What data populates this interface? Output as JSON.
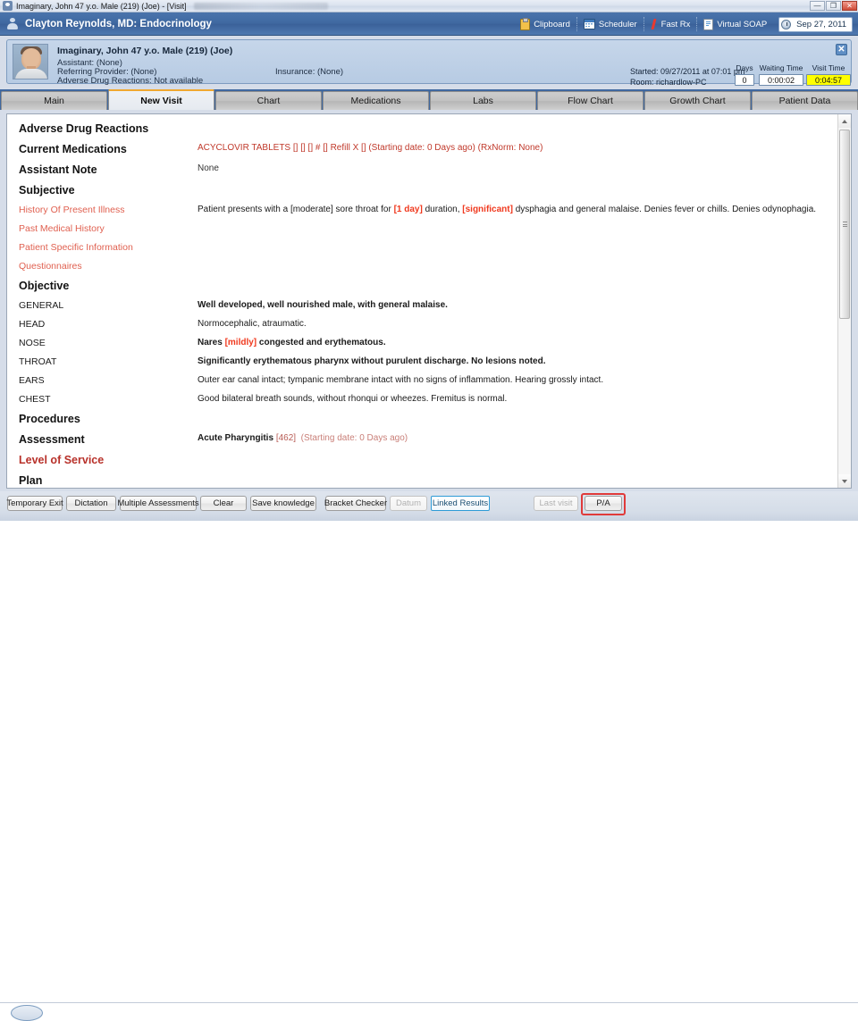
{
  "window": {
    "title": "Imaginary, John 47 y.o. Male (219) (Joe) - [Visit]",
    "icon": "user-icon",
    "buttons": {
      "minimize": "—",
      "maximize": "❐",
      "close": "✕"
    }
  },
  "app_header": {
    "title": "Clayton Reynolds, MD: Endocrinology",
    "user_icon": "user-icon",
    "tools": [
      {
        "label": "Clipboard",
        "icon": "clipboard-icon"
      },
      {
        "label": "Scheduler",
        "icon": "calendar-icon"
      },
      {
        "label": "Fast Rx",
        "icon": "prescription-icon"
      },
      {
        "label": "Virtual SOAP",
        "icon": "document-icon"
      }
    ],
    "date": {
      "label": "Sep 27, 2011",
      "icon": "clock-icon"
    }
  },
  "patient_banner": {
    "avatar": "patient-photo",
    "name": "Imaginary, John 47 y.o. Male (219) (Joe)",
    "assistant": "Assistant: (None)",
    "referring_provider": "Referring Provider: (None)",
    "adverse_drug_reactions": "Adverse Drug Reactions: Not available",
    "insurance": "Insurance: (None)",
    "started": "Started: 09/27/2011 at 07:01 pm",
    "room": "Room: richardlow-PC",
    "timers": [
      {
        "label": "Days",
        "value": "0",
        "highlight": false
      },
      {
        "label": "Waiting Time",
        "value": "0:00:02",
        "highlight": false
      },
      {
        "label": "Visit Time",
        "value": "0:04:57",
        "highlight": true
      }
    ],
    "close_icon": "close-icon"
  },
  "tabs": [
    {
      "label": "Main",
      "active": false
    },
    {
      "label": "New Visit",
      "active": true
    },
    {
      "label": "Chart",
      "active": false
    },
    {
      "label": "Medications",
      "active": false
    },
    {
      "label": "Labs",
      "active": false
    },
    {
      "label": "Flow Chart",
      "active": false
    },
    {
      "label": "Growth Chart",
      "active": false
    },
    {
      "label": "Patient Data",
      "active": false
    }
  ],
  "note": {
    "adverse_drug_reactions": {
      "label": "Adverse Drug Reactions",
      "value": ""
    },
    "current_medications": {
      "label": "Current Medications",
      "value": "ACYCLOVIR TABLETS  [] [] []  # []   Refill X []   (Starting date: 0 Days ago) (RxNorm: None)"
    },
    "assistant_note": {
      "label": "Assistant Note",
      "value": "None"
    },
    "subjective": {
      "label": "Subjective",
      "items": [
        {
          "label": "History Of Present Illness"
        },
        {
          "label": "Past Medical History"
        },
        {
          "label": "Patient Specific Information"
        },
        {
          "label": "Questionnaires"
        }
      ],
      "hpi_parts": [
        {
          "text": "Patient presents with a [moderate]  sore throat for ",
          "style": "plain"
        },
        {
          "text": "[1 day]",
          "style": "highlight"
        },
        {
          "text": "  duration, ",
          "style": "plain"
        },
        {
          "text": "[significant]",
          "style": "highlight"
        },
        {
          "text": "  dysphagia and general malaise. Denies fever or chills. Denies odynophagia.",
          "style": "plain"
        }
      ]
    },
    "objective": {
      "label": "Objective",
      "rows": [
        {
          "label": "GENERAL",
          "value": "Well developed, well nourished male, with general malaise.",
          "bold": true
        },
        {
          "label": "HEAD",
          "value": "Normocephalic, atraumatic.",
          "bold": false
        },
        {
          "label": "NOSE",
          "value": "",
          "bold": true,
          "parts": [
            {
              "text": "Nares ",
              "style": "bold"
            },
            {
              "text": "[mildly]",
              "style": "highlight"
            },
            {
              "text": " congested and erythematous.",
              "style": "bold"
            }
          ]
        },
        {
          "label": "THROAT",
          "value": "Significantly erythematous pharynx without purulent discharge. No lesions noted.",
          "bold": true
        },
        {
          "label": "EARS",
          "value": "Outer ear canal intact; tympanic membrane intact with no signs of inflammation. Hearing grossly intact.",
          "bold": false
        },
        {
          "label": "CHEST",
          "value": "Good bilateral breath sounds, without rhonqui or wheezes. Fremitus is normal.",
          "bold": false
        }
      ]
    },
    "procedures": {
      "label": "Procedures",
      "value": ""
    },
    "assessment": {
      "label": "Assessment",
      "diagnosis": "Acute Pharyngitis",
      "code": "[462]",
      "date": "(Starting date: 0 Days ago)"
    },
    "level_of_service": {
      "label": "Level of Service"
    },
    "plan": {
      "label": "Plan"
    }
  },
  "toolbar": {
    "buttons": [
      {
        "label": "Temporary Exit",
        "state": "normal"
      },
      {
        "label": "Dictation",
        "state": "normal"
      },
      {
        "label": "Multiple Assessments",
        "state": "normal"
      },
      {
        "label": "Clear",
        "state": "normal"
      },
      {
        "label": "Save knowledge",
        "state": "normal"
      },
      {
        "label": "Bracket Checker",
        "state": "normal"
      },
      {
        "label": "Datum",
        "state": "disabled"
      },
      {
        "label": "Linked Results",
        "state": "accent"
      },
      {
        "label": "Last visit",
        "state": "disabled"
      },
      {
        "label": "P/A",
        "state": "highlighted"
      }
    ]
  },
  "colors": {
    "header_blue": "#3f68a0",
    "active_tab_accent": "#f0a830",
    "highlight_red": "#f0391e",
    "med_red": "#c0392b",
    "sub_label_red": "#e06050",
    "section_red": "#b8312a",
    "visit_timer_yellow": "#ffff00",
    "button_highlight": "#e03a3a"
  }
}
